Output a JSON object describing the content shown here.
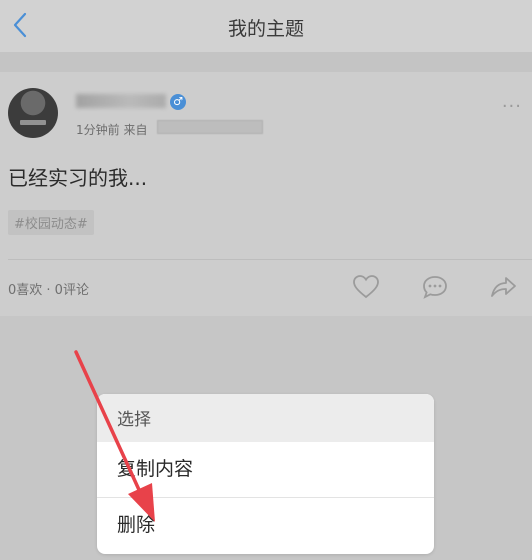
{
  "header": {
    "title": "我的主题"
  },
  "post": {
    "meta_prefix": "1分钟前 来自",
    "content": "已经实习的我...",
    "tag": "#校园动态#",
    "stats": "0喜欢 · 0评论",
    "more": "···"
  },
  "menu": {
    "title": "选择",
    "items": [
      "复制内容",
      "删除"
    ]
  },
  "colors": {
    "accent": "#4a8fd6",
    "arrow": "#e8424a"
  },
  "icons": [
    "back-chevron-icon",
    "verified-badge-icon",
    "more-icon",
    "like-heart-icon",
    "comment-icon",
    "share-icon"
  ]
}
